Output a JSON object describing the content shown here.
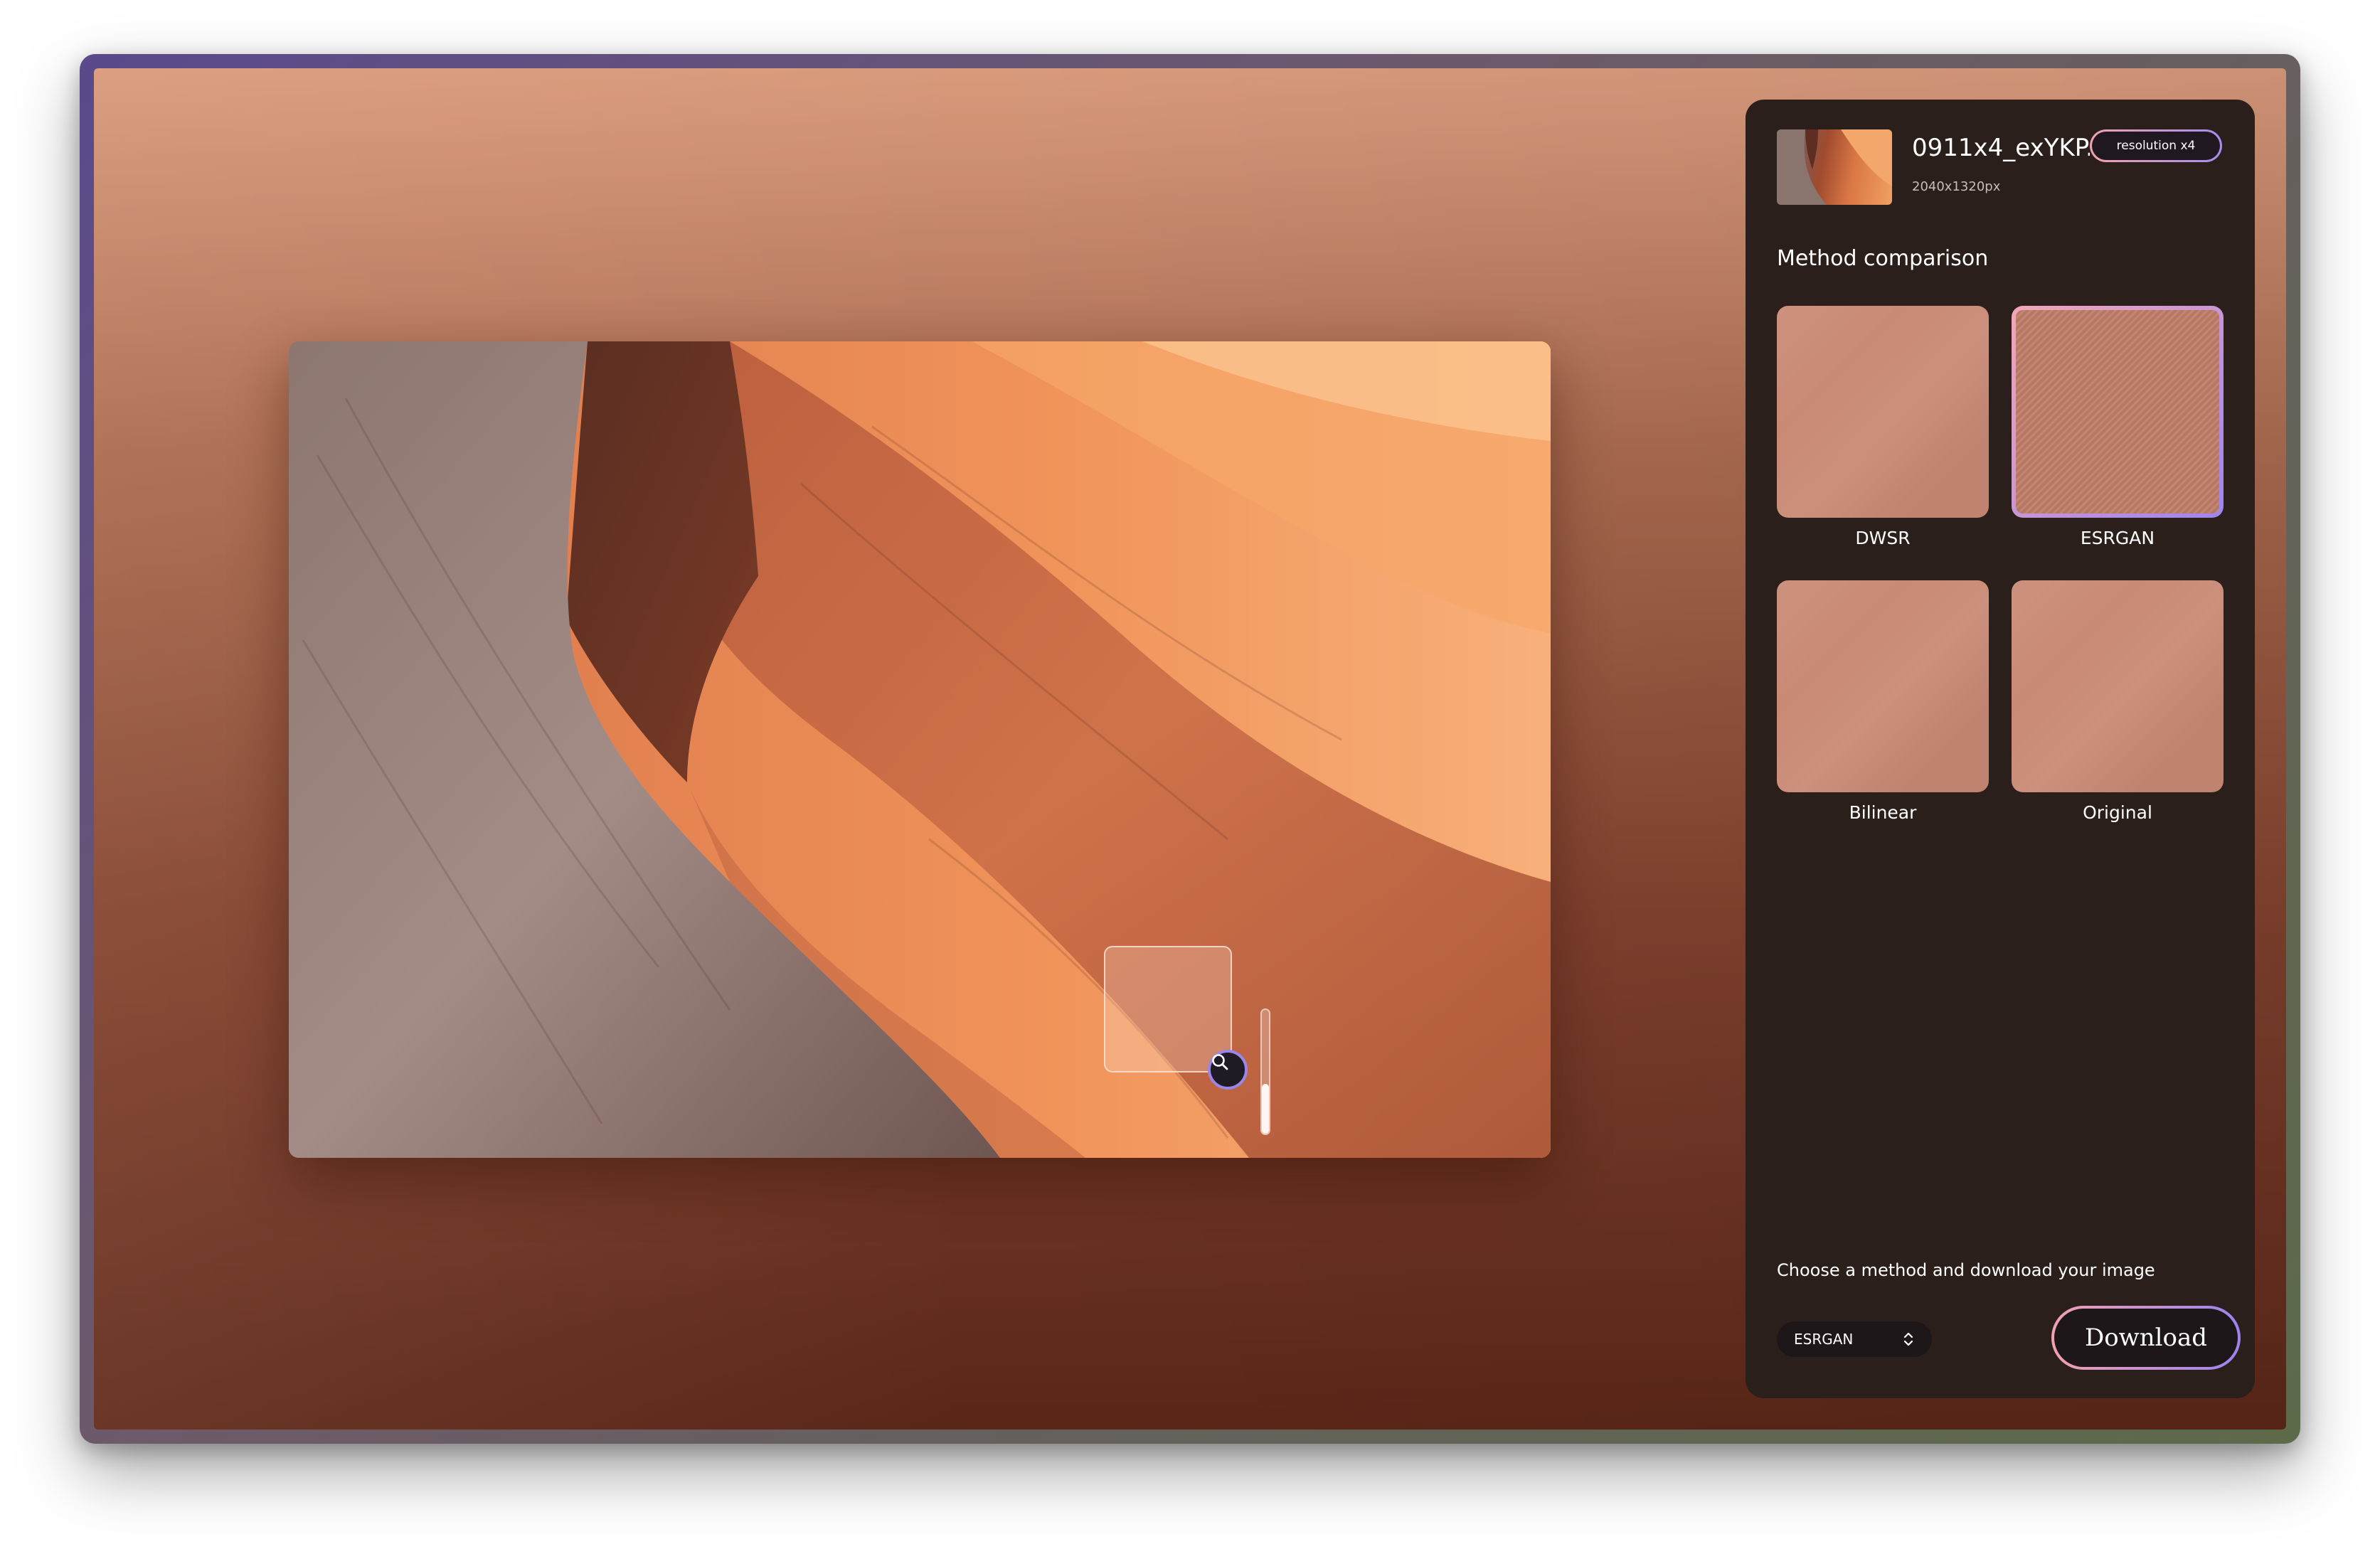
{
  "file": {
    "name": "0911x4_exYKP...",
    "dimensions": "2040x1320px",
    "badge": "resolution x4"
  },
  "panel": {
    "section_title": "Method comparison",
    "methods": [
      {
        "label": "DWSR",
        "selected": false
      },
      {
        "label": "ESRGAN",
        "selected": true
      },
      {
        "label": "Bilinear",
        "selected": false
      },
      {
        "label": "Original",
        "selected": false
      }
    ],
    "cta_text": "Choose a method and download your image",
    "select_value": "ESRGAN",
    "download_label": "Download"
  },
  "viewer": {
    "zoom_level_fraction": 0.4
  },
  "colors": {
    "accent_start": "#f2a0b2",
    "accent_end": "#9b84ee",
    "panel_bg": "#2b1f1b"
  }
}
